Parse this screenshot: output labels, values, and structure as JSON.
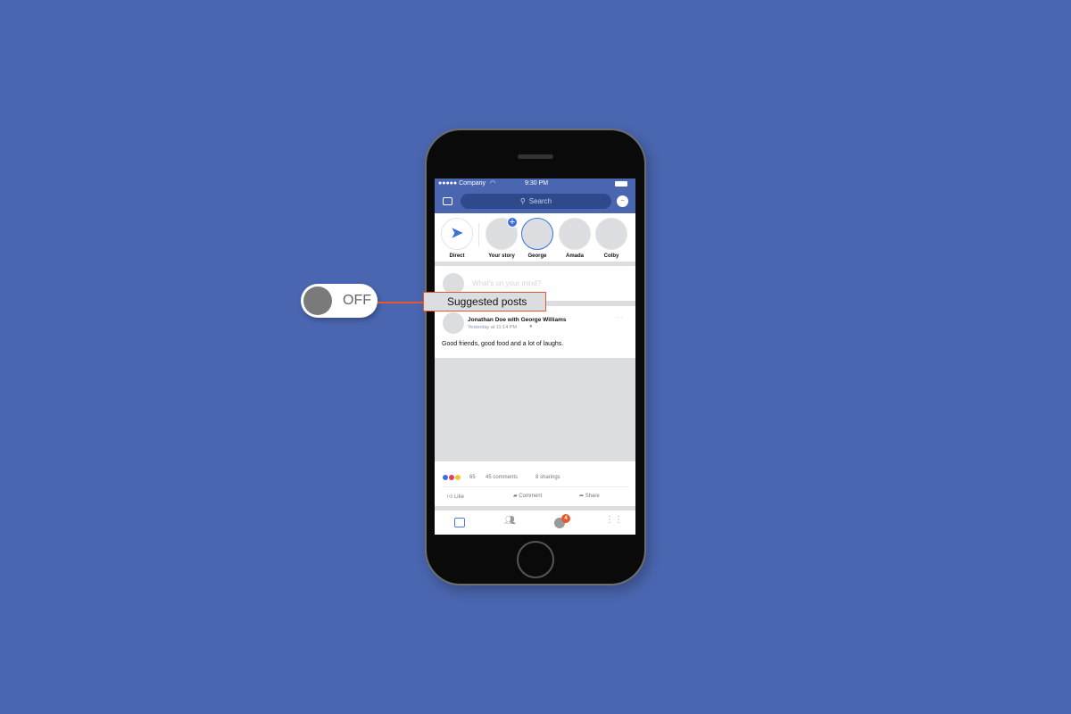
{
  "status_bar": {
    "carrier": "●●●●● Company",
    "time": "9:30 PM"
  },
  "nav": {
    "search_placeholder": "Search"
  },
  "stories": [
    {
      "label": "Direct"
    },
    {
      "label": "Your story"
    },
    {
      "label": "George"
    },
    {
      "label": "Amada"
    },
    {
      "label": "Colby"
    }
  ],
  "composer": {
    "placeholder": "What's on your mind?"
  },
  "post": {
    "author": "Jonathan Doe with George Williams",
    "time": "Yesterday at 11:14 PM",
    "text": "Good friends, good food and a lot of laughs.",
    "reactions_count": "65",
    "comments": "45 comments",
    "shares": "8 sharings",
    "actions": [
      "Like",
      "Comment",
      "Share"
    ]
  },
  "tabbar": {
    "notification_badge": "4"
  },
  "callout": {
    "toggle_state": "OFF",
    "label": "Suggested posts"
  },
  "colors": {
    "brand": "#4a66b0",
    "accent": "#e8572a"
  }
}
